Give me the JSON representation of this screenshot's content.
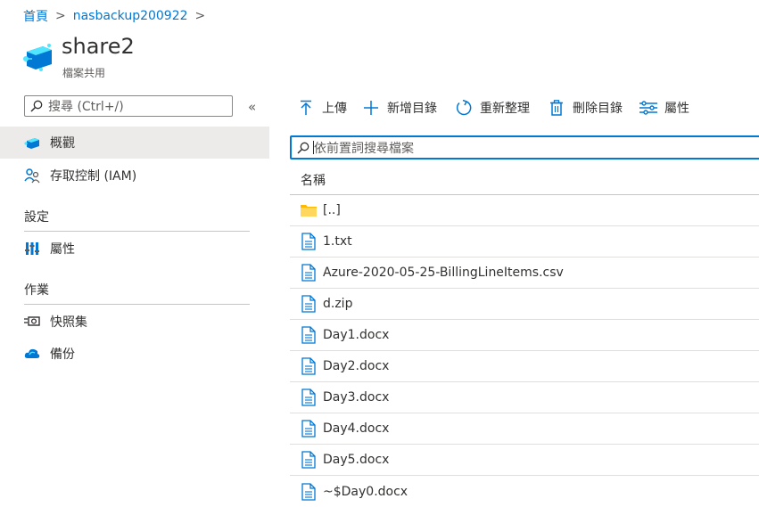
{
  "breadcrumb": {
    "home": "首頁",
    "account": "nasbackup200922"
  },
  "header": {
    "title": "share2",
    "subtitle": "檔案共用"
  },
  "sidebar": {
    "search_placeholder": "搜尋 (Ctrl+/)",
    "collapse_glyph": "«",
    "items": [
      {
        "label": "概觀",
        "icon": "overview-icon",
        "active": true
      },
      {
        "label": "存取控制 (IAM)",
        "icon": "iam-icon"
      }
    ],
    "sections": [
      {
        "title": "設定",
        "items": [
          {
            "label": "屬性",
            "icon": "properties-icon"
          }
        ]
      },
      {
        "title": "作業",
        "items": [
          {
            "label": "快照集",
            "icon": "snapshot-icon"
          },
          {
            "label": "備份",
            "icon": "backup-icon"
          }
        ]
      }
    ]
  },
  "toolbar": {
    "upload": "上傳",
    "add_directory": "新增目錄",
    "refresh": "重新整理",
    "delete_directory": "刪除目錄",
    "properties": "屬性"
  },
  "file_search": {
    "placeholder": "依前置詞搜尋檔案"
  },
  "table": {
    "column_name": "名稱",
    "rows": [
      {
        "name": "[..]",
        "type": "folder"
      },
      {
        "name": "1.txt",
        "type": "file"
      },
      {
        "name": "Azure-2020-05-25-BillingLineItems.csv",
        "type": "file"
      },
      {
        "name": "d.zip",
        "type": "file"
      },
      {
        "name": "Day1.docx",
        "type": "file"
      },
      {
        "name": "Day2.docx",
        "type": "file"
      },
      {
        "name": "Day3.docx",
        "type": "file"
      },
      {
        "name": "Day4.docx",
        "type": "file"
      },
      {
        "name": "Day5.docx",
        "type": "file"
      },
      {
        "name": "~$Day0.docx",
        "type": "file"
      }
    ]
  },
  "colors": {
    "accent": "#0078d4",
    "folder": "#ffb900",
    "selected_bg": "#edebe9"
  }
}
